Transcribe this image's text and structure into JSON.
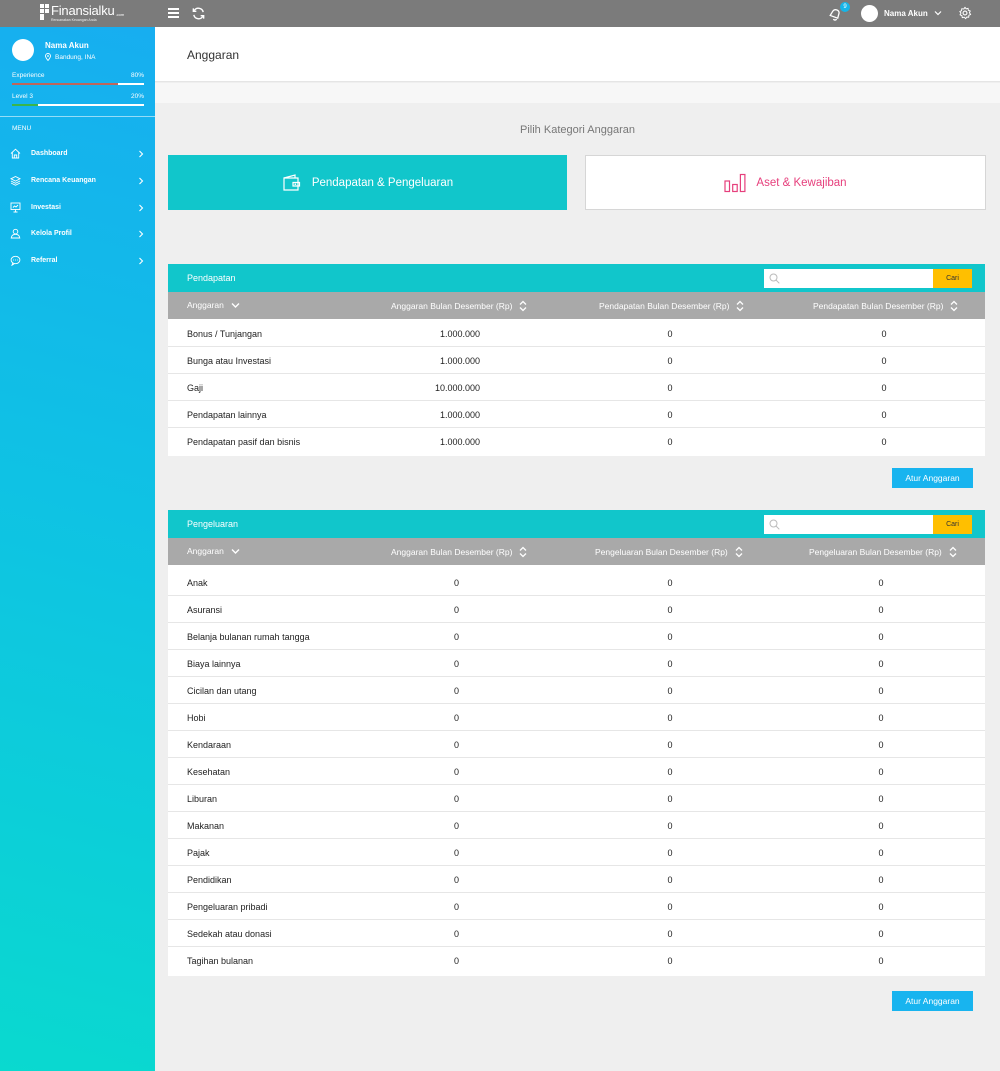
{
  "topbar": {
    "logo_text": "Finansialku",
    "logo_suffix": ".com",
    "logo_tagline": "Rencanakan Keuangan Anda",
    "notification_count": "9",
    "user_name": "Nama Akun"
  },
  "sidebar": {
    "user_name": "Nama Akun",
    "location": "Bandung, INA",
    "experience": {
      "label": "Experience",
      "percent_text": "80%",
      "percent": 0.8,
      "color": "#c0655a"
    },
    "level": {
      "label": "Level 3",
      "percent_text": "20%",
      "percent": 0.2,
      "color": "#3ab54a"
    },
    "menu_title": "MENU",
    "items": [
      {
        "label": "Dashboard",
        "icon": "home-icon"
      },
      {
        "label": "Rencana Keuangan",
        "icon": "layers-icon"
      },
      {
        "label": "Investasi",
        "icon": "presentation-chart-icon"
      },
      {
        "label": "Kelola Profil",
        "icon": "user-icon"
      },
      {
        "label": "Referral",
        "icon": "chat-bubble-icon"
      }
    ]
  },
  "page": {
    "title": "Anggaran",
    "category_title": "Pilih Kategori Anggaran",
    "category_income": "Pendapatan & Pengeluaran",
    "category_asset": "Aset & Kewajiban"
  },
  "income": {
    "title": "Pendapatan",
    "search_placeholder": "",
    "search_button": "Cari",
    "columns": [
      "Anggaran",
      "Anggaran Bulan Desember (Rp)",
      "Pendapatan Bulan Desember (Rp)",
      "Pendapatan Bulan Desember (Rp)"
    ],
    "rows": [
      [
        "Bonus / Tunjangan",
        "1.000.000",
        "0",
        "0"
      ],
      [
        "Bunga atau Investasi",
        "1.000.000",
        "0",
        "0"
      ],
      [
        "Gaji",
        "10.000.000",
        "0",
        "0"
      ],
      [
        "Pendapatan lainnya",
        "1.000.000",
        "0",
        "0"
      ],
      [
        "Pendapatan pasif dan bisnis",
        "1.000.000",
        "0",
        "0"
      ]
    ],
    "button": "Atur Anggaran"
  },
  "expense": {
    "title": "Pengeluaran",
    "search_placeholder": "",
    "search_button": "Cari",
    "columns": [
      "Anggaran",
      "Anggaran Bulan Desember (Rp)",
      "Pengeluaran Bulan Desember (Rp)",
      "Pengeluaran Bulan Desember (Rp)"
    ],
    "rows": [
      [
        "Anak",
        "0",
        "0",
        "0"
      ],
      [
        "Asuransi",
        "0",
        "0",
        "0"
      ],
      [
        "Belanja bulanan rumah tangga",
        "0",
        "0",
        "0"
      ],
      [
        "Biaya lainnya",
        "0",
        "0",
        "0"
      ],
      [
        "Cicilan dan utang",
        "0",
        "0",
        "0"
      ],
      [
        "Hobi",
        "0",
        "0",
        "0"
      ],
      [
        "Kendaraan",
        "0",
        "0",
        "0"
      ],
      [
        "Kesehatan",
        "0",
        "0",
        "0"
      ],
      [
        "Liburan",
        "0",
        "0",
        "0"
      ],
      [
        "Makanan",
        "0",
        "0",
        "0"
      ],
      [
        "Pajak",
        "0",
        "0",
        "0"
      ],
      [
        "Pendidikan",
        "0",
        "0",
        "0"
      ],
      [
        "Pengeluaran pribadi",
        "0",
        "0",
        "0"
      ],
      [
        "Sedekah atau donasi",
        "0",
        "0",
        "0"
      ],
      [
        "Tagihan bulanan",
        "0",
        "0",
        "0"
      ]
    ],
    "button": "Atur Anggaran"
  },
  "colors": {
    "teal": "#11c6cb",
    "button_blue": "#18b4ef",
    "search_yellow": "#ffbf00",
    "asset_pink": "#e63f7c",
    "topbar_gray": "#7b7b7b"
  }
}
